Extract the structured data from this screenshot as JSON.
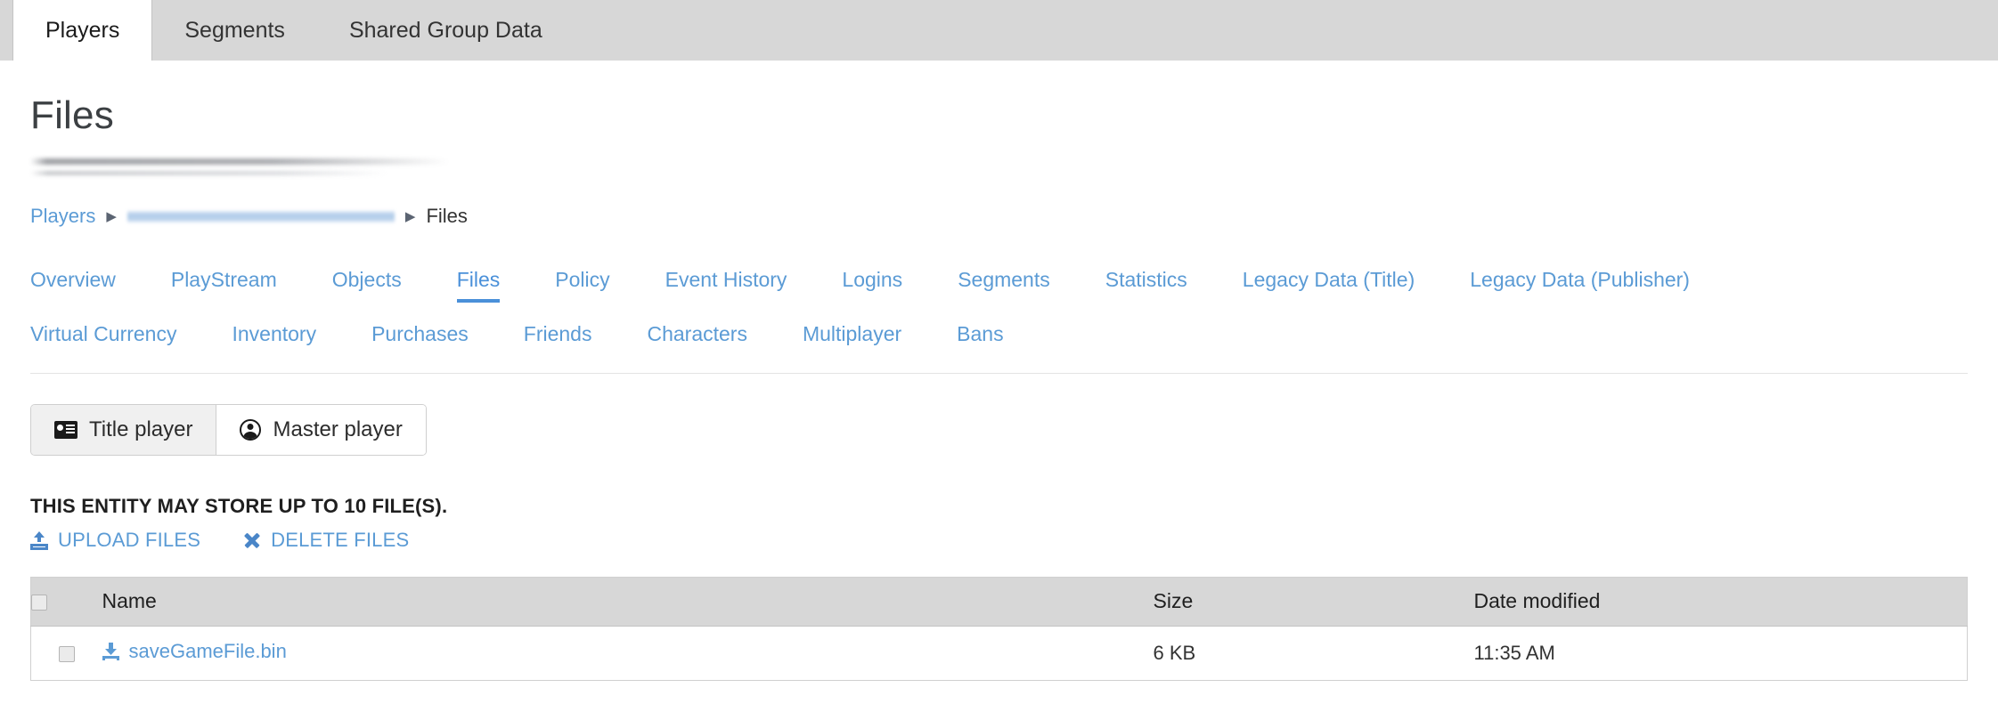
{
  "colors": {
    "link_blue": "#5b9bd5",
    "active_underline": "#4a90d9",
    "tabbar_bg": "#d7d7d7",
    "table_header_bg": "#d7d7d7",
    "title_text": "#3c4043"
  },
  "top_tabs": [
    {
      "label": "Players",
      "active": true
    },
    {
      "label": "Segments",
      "active": false
    },
    {
      "label": "Shared Group Data",
      "active": false
    }
  ],
  "header": {
    "title": "Files"
  },
  "breadcrumb": {
    "root_label": "Players",
    "separator": "▶",
    "redacted": "",
    "current_label": "Files"
  },
  "subnav": {
    "row1": [
      {
        "label": "Overview",
        "active": false
      },
      {
        "label": "PlayStream",
        "active": false
      },
      {
        "label": "Objects",
        "active": false
      },
      {
        "label": "Files",
        "active": true
      },
      {
        "label": "Policy",
        "active": false
      },
      {
        "label": "Event History",
        "active": false
      },
      {
        "label": "Logins",
        "active": false
      },
      {
        "label": "Segments",
        "active": false
      },
      {
        "label": "Statistics",
        "active": false
      },
      {
        "label": "Legacy Data (Title)",
        "active": false
      },
      {
        "label": "Legacy Data (Publisher)",
        "active": false
      }
    ],
    "row2": [
      {
        "label": "Virtual Currency",
        "active": false
      },
      {
        "label": "Inventory",
        "active": false
      },
      {
        "label": "Purchases",
        "active": false
      },
      {
        "label": "Friends",
        "active": false
      },
      {
        "label": "Characters",
        "active": false
      },
      {
        "label": "Multiplayer",
        "active": false
      },
      {
        "label": "Bans",
        "active": false
      }
    ]
  },
  "player_toggle": {
    "title_player": {
      "label": "Title player",
      "icon": "id-card-icon",
      "active": true
    },
    "master_player": {
      "label": "Master player",
      "icon": "person-circle-icon",
      "active": false
    }
  },
  "quota": {
    "text": "THIS ENTITY MAY STORE UP TO 10 FILE(S).",
    "max_files": 10
  },
  "actions": {
    "upload": {
      "label": "UPLOAD FILES",
      "icon": "upload-icon"
    },
    "delete": {
      "label": "DELETE FILES",
      "icon": "x-icon"
    }
  },
  "table": {
    "columns": [
      "",
      "Name",
      "Size",
      "Date modified"
    ],
    "rows": [
      {
        "selected": false,
        "name": "saveGameFile.bin",
        "size": "6 KB",
        "date_modified": "11:35 AM",
        "icon": "download-icon"
      }
    ]
  }
}
